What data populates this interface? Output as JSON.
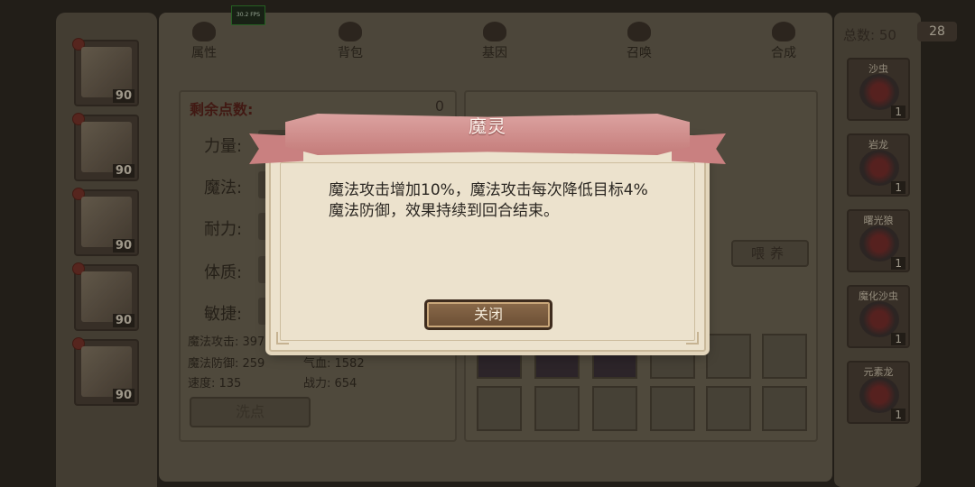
{
  "fps": "30.2 FPS",
  "tabs": [
    {
      "label": "属性",
      "icon": "attribute-tab-icon"
    },
    {
      "label": "背包",
      "icon": "bag-tab-icon"
    },
    {
      "label": "基因",
      "icon": "gene-tab-icon"
    },
    {
      "label": "召唤",
      "icon": "summon-tab-icon"
    },
    {
      "label": "合成",
      "icon": "craft-tab-icon"
    }
  ],
  "total": {
    "label": "总数: 50",
    "value": "28"
  },
  "heroes": [
    {
      "level": "90"
    },
    {
      "level": "90"
    },
    {
      "level": "90"
    },
    {
      "level": "90"
    },
    {
      "level": "90"
    },
    {
      "level": ""
    }
  ],
  "stats": {
    "remaining_label": "剩余点数:",
    "remaining_value": "0",
    "rows": [
      "力量:",
      "魔法:",
      "耐力:",
      "体质:",
      "敏捷:"
    ],
    "magic_attack": "魔法攻击: 397",
    "magic_defense": "魔法防御: 259",
    "speed": "速度: 135",
    "hp": "气血: 1582",
    "power": "战力: 654",
    "wash_button": "洗点"
  },
  "pet_panel": {
    "feed_button": "喂养"
  },
  "pets": [
    {
      "name": "沙虫",
      "count": "1"
    },
    {
      "name": "岩龙",
      "count": "1"
    },
    {
      "name": "曙光狼",
      "count": "1"
    },
    {
      "name": "魔化沙虫",
      "count": "1"
    },
    {
      "name": "元素龙",
      "count": "1"
    }
  ],
  "modal": {
    "title": "魔灵",
    "description": "魔法攻击增加10%，魔法攻击每次降低目标4%魔法防御，效果持续到回合结束。",
    "close_button": "关闭"
  }
}
